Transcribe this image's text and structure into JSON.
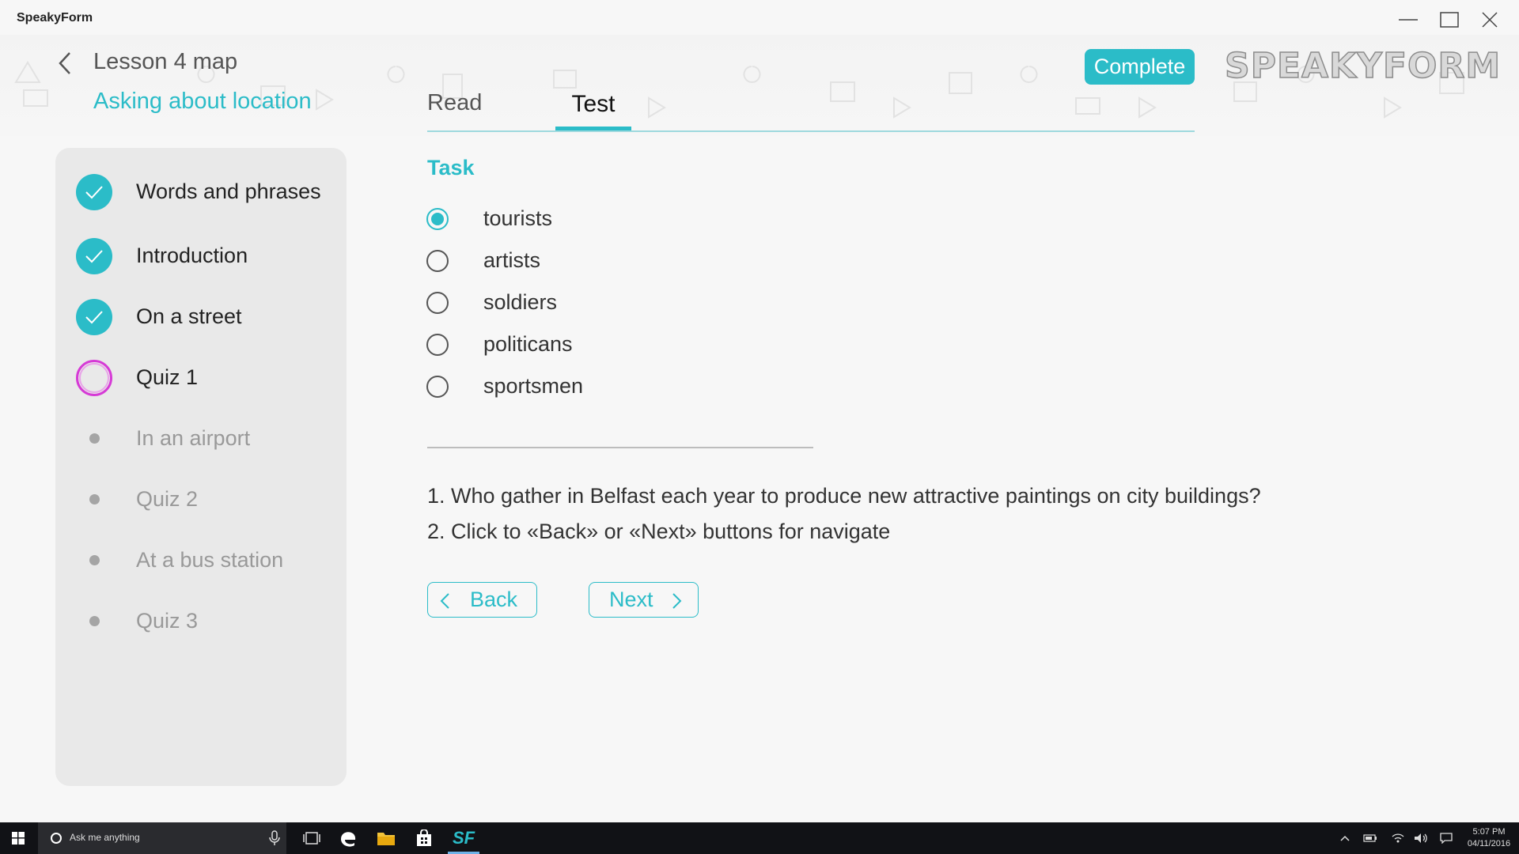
{
  "app": {
    "title": "SpeakyForm"
  },
  "header": {
    "lesson_title": "Lesson 4 map",
    "lesson_subtitle": "Asking about location",
    "tabs": [
      {
        "label": "Read",
        "active": false
      },
      {
        "label": "Test",
        "active": true
      }
    ],
    "complete_label": "Complete",
    "brand": "SPEAKYFORM"
  },
  "sidebar": {
    "items": [
      {
        "label": "Words and phrases",
        "status": "done"
      },
      {
        "label": "Introduction",
        "status": "done"
      },
      {
        "label": "On a street",
        "status": "done"
      },
      {
        "label": "Quiz 1",
        "status": "current"
      },
      {
        "label": "In an airport",
        "status": "pending"
      },
      {
        "label": "Quiz 2",
        "status": "pending"
      },
      {
        "label": "At a bus station",
        "status": "pending"
      },
      {
        "label": "Quiz 3",
        "status": "pending"
      }
    ]
  },
  "task": {
    "label": "Task",
    "options": [
      {
        "label": "tourists",
        "selected": true
      },
      {
        "label": "artists",
        "selected": false
      },
      {
        "label": "soldiers",
        "selected": false
      },
      {
        "label": "politicans",
        "selected": false
      },
      {
        "label": "sportsmen",
        "selected": false
      }
    ],
    "instructions": [
      "1. Who gather in Belfast each year to produce new attractive paintings on city buildings?",
      "2. Click to «Back» or «Next»  buttons for navigate"
    ],
    "back_label": "Back",
    "next_label": "Next"
  },
  "taskbar": {
    "search_placeholder": "Ask me anything",
    "app_label": "SF",
    "time": "5:07 PM",
    "date": "04/11/2016"
  },
  "colors": {
    "accent": "#2bbcc8",
    "current_step": "#d63ad6",
    "pending_step": "#a5a5a5"
  }
}
